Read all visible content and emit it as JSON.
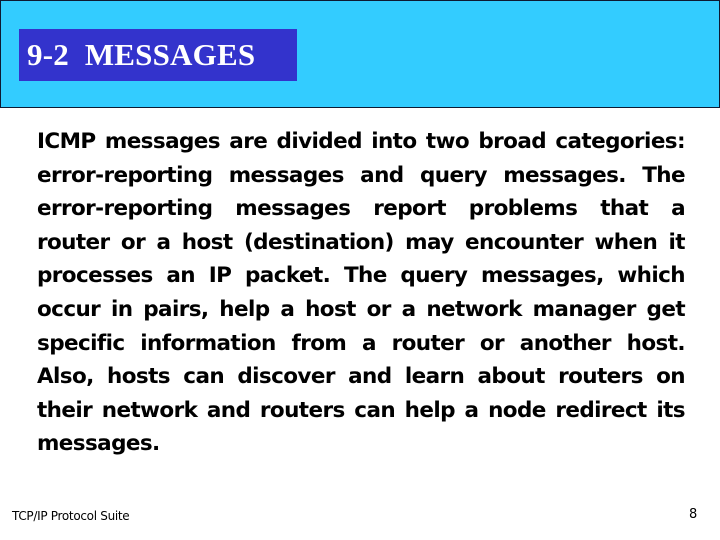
{
  "slide": {
    "title": "9-2  MESSAGES",
    "body": "ICMP messages are divided into two broad categories: error-reporting messages and query messages. The error-reporting messages report problems that a router or a host (destination) may encounter when it processes an IP packet. The query messages, which occur in pairs, help a host or a network manager get specific information from a router or another host. Also, hosts can discover and learn about routers on their network and routers can help a node redirect its messages."
  },
  "footer": {
    "source": "TCP/IP Protocol Suite",
    "page_number": "8"
  },
  "colors": {
    "header_band": "#33ccff",
    "title_box": "#3333cc",
    "title_text": "#ffffff",
    "body_text": "#000000"
  }
}
